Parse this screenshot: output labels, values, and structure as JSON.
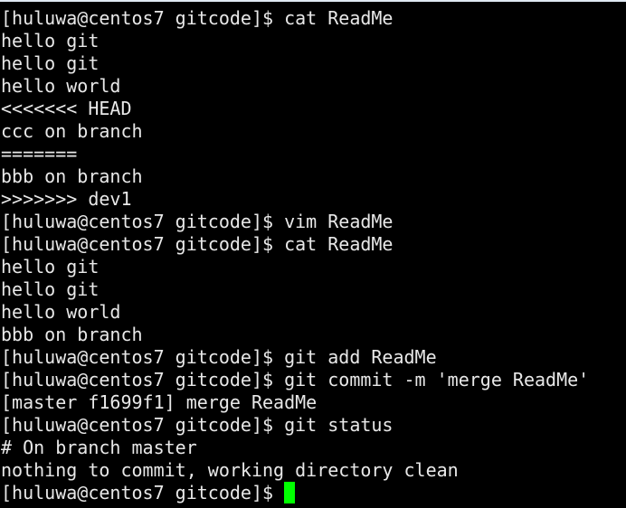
{
  "terminal": {
    "lines": [
      "[huluwa@centos7 gitcode]$ cat ReadMe",
      "hello git",
      "hello git",
      "hello world",
      "<<<<<<< HEAD",
      "ccc on branch",
      "=======",
      "bbb on branch",
      ">>>>>>> dev1",
      "[huluwa@centos7 gitcode]$ vim ReadMe",
      "[huluwa@centos7 gitcode]$ cat ReadMe",
      "hello git",
      "hello git",
      "hello world",
      "bbb on branch",
      "[huluwa@centos7 gitcode]$ git add ReadMe",
      "[huluwa@centos7 gitcode]$ git commit -m 'merge ReadMe'",
      "[master f1699f1] merge ReadMe",
      "[huluwa@centos7 gitcode]$ git status",
      "# On branch master",
      "nothing to commit, working directory clean"
    ],
    "prompt": "[huluwa@centos7 gitcode]$ ",
    "cursor_color": "#00ff00",
    "background": "#000000",
    "foreground": "#e8e8e8"
  }
}
